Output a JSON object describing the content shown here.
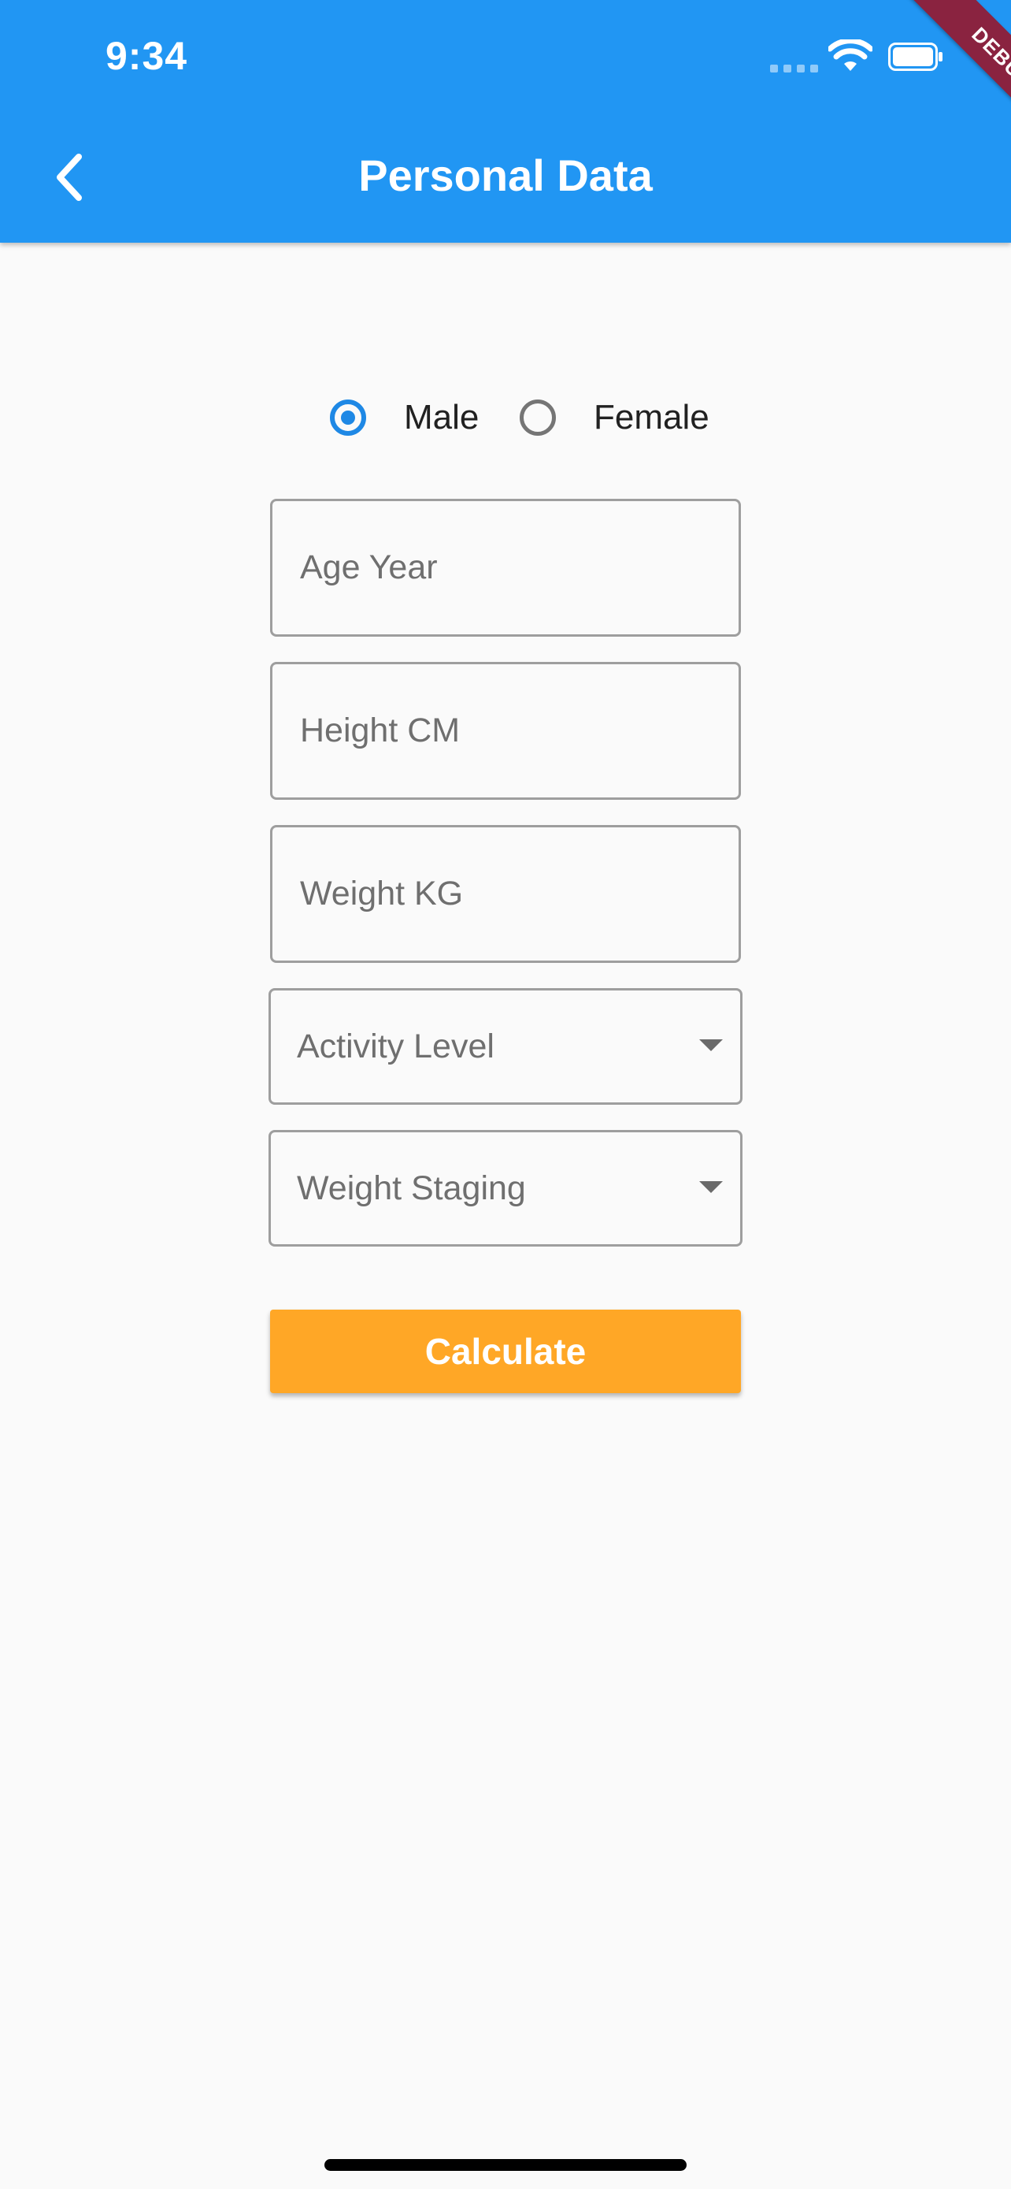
{
  "status_bar": {
    "time": "9:34",
    "signal_icon": "cellular-dots-icon",
    "wifi_icon": "wifi-icon",
    "battery_icon": "battery-icon"
  },
  "app_bar": {
    "title": "Personal Data",
    "back_icon": "chevron-left-icon",
    "background_color": "#2196f3"
  },
  "debug_banner": {
    "label": "DEBUG",
    "color": "#8a2340"
  },
  "gender": {
    "options": [
      {
        "label": "Male",
        "selected": true
      },
      {
        "label": "Female",
        "selected": false
      }
    ],
    "accent_color": "#1e88e5"
  },
  "form": {
    "age_placeholder": "Age Year",
    "height_placeholder": "Height CM",
    "weight_placeholder": "Weight KG",
    "activity_level_label": "Activity Level",
    "weight_staging_label": "Weight Staging",
    "dropdown_icon": "caret-down-icon"
  },
  "actions": {
    "calculate_label": "Calculate",
    "calculate_color": "#ffa726"
  }
}
